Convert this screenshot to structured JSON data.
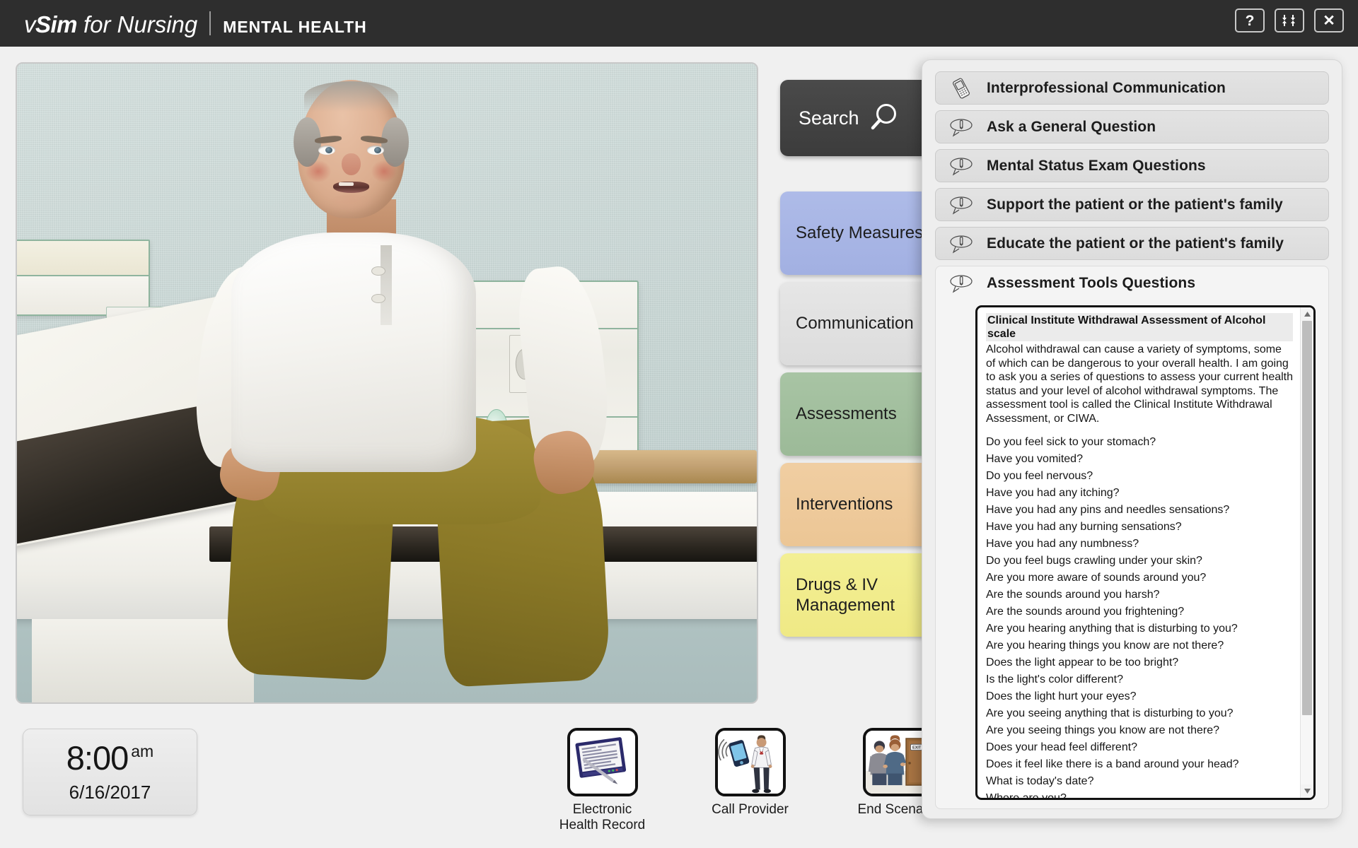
{
  "titlebar": {
    "logo_v": "v",
    "logo_sim": "Sim",
    "logo_for": "for",
    "logo_nursing": "Nursing",
    "logo_subtitle": "MENTAL HEALTH",
    "buttons": [
      {
        "name": "help",
        "glyph": "?"
      },
      {
        "name": "resize",
        "glyph": ""
      },
      {
        "name": "close",
        "glyph": "✕"
      }
    ]
  },
  "scene": {
    "description": "Simulation scene: older male patient with flushed face seated on an exam table in a clinic room"
  },
  "clock": {
    "time": "8:00",
    "ampm": "am",
    "date": "6/16/2017"
  },
  "actions": [
    {
      "icon": "electronic-health-record-icon",
      "label_line1": "Electronic",
      "label_line2": "Health Record"
    },
    {
      "icon": "call-provider-icon",
      "label_line1": "Call Provider",
      "label_line2": ""
    },
    {
      "icon": "end-scenario-icon",
      "label_line1": "End Scenario",
      "label_line2": ""
    }
  ],
  "rail": {
    "search_label": "Search",
    "search_icon": "magnifier-icon",
    "categories": [
      {
        "key": "safety",
        "label": "Safety Measures",
        "color": "#aebbe8"
      },
      {
        "key": "communication",
        "label": "Communication",
        "color": "#e6e6e6"
      },
      {
        "key": "assessments",
        "label": "Assessments",
        "color": "#a8c4a4"
      },
      {
        "key": "interventions",
        "label": "Interventions",
        "color": "#f0cea2"
      },
      {
        "key": "drugs",
        "label": "Drugs & IV Management",
        "color": "#f3ef94"
      }
    ]
  },
  "action_panel": {
    "menu_items": [
      {
        "icon": "mobile-phone-icon",
        "label": "Interprofessional Communication",
        "expanded": false
      },
      {
        "icon": "speech-bubble-pen-icon",
        "label": "Ask a General Question",
        "expanded": false
      },
      {
        "icon": "speech-bubble-pen-icon",
        "label": "Mental Status Exam Questions",
        "expanded": false
      },
      {
        "icon": "speech-bubble-pen-icon",
        "label": "Support the patient or the patient's family",
        "expanded": false
      },
      {
        "icon": "speech-bubble-pen-icon",
        "label": "Educate the patient or the patient's family",
        "expanded": false
      },
      {
        "icon": "speech-bubble-pen-icon",
        "label": "Assessment Tools Questions",
        "expanded": true
      }
    ],
    "ciwa": {
      "title": "Clinical Institute Withdrawal Assessment of Alcohol scale",
      "intro": "Alcohol withdrawal can cause a variety of symptoms, some of which can be dangerous to your overall health. I am going to ask you a series of questions to assess your current health status and your level of alcohol withdrawal symptoms. The assessment tool is called the Clinical Institute Withdrawal Assessment, or CIWA.",
      "questions": [
        "Do you feel sick to your stomach?",
        "Have you vomited?",
        "Do you feel nervous?",
        "Have you had any itching?",
        "Have you had any pins and needles sensations?",
        "Have you had any burning sensations?",
        "Have you had any numbness?",
        "Do you feel bugs crawling under your skin?",
        "Are you more aware of sounds around you?",
        "Are the sounds around you harsh?",
        "Are the sounds around you frightening?",
        "Are you hearing anything that is disturbing to you?",
        "Are you hearing things you know are not there?",
        "Does the light appear to be too bright?",
        "Is the light's color different?",
        "Does the light hurt your eyes?",
        "Are you seeing anything that is disturbing to you?",
        "Are you seeing things you know are not there?",
        "Does your head feel different?",
        "Does it feel like there is a band around your head?",
        "What is today's date?",
        "Where are you?"
      ],
      "scroll_thumb_percent": 85
    }
  }
}
